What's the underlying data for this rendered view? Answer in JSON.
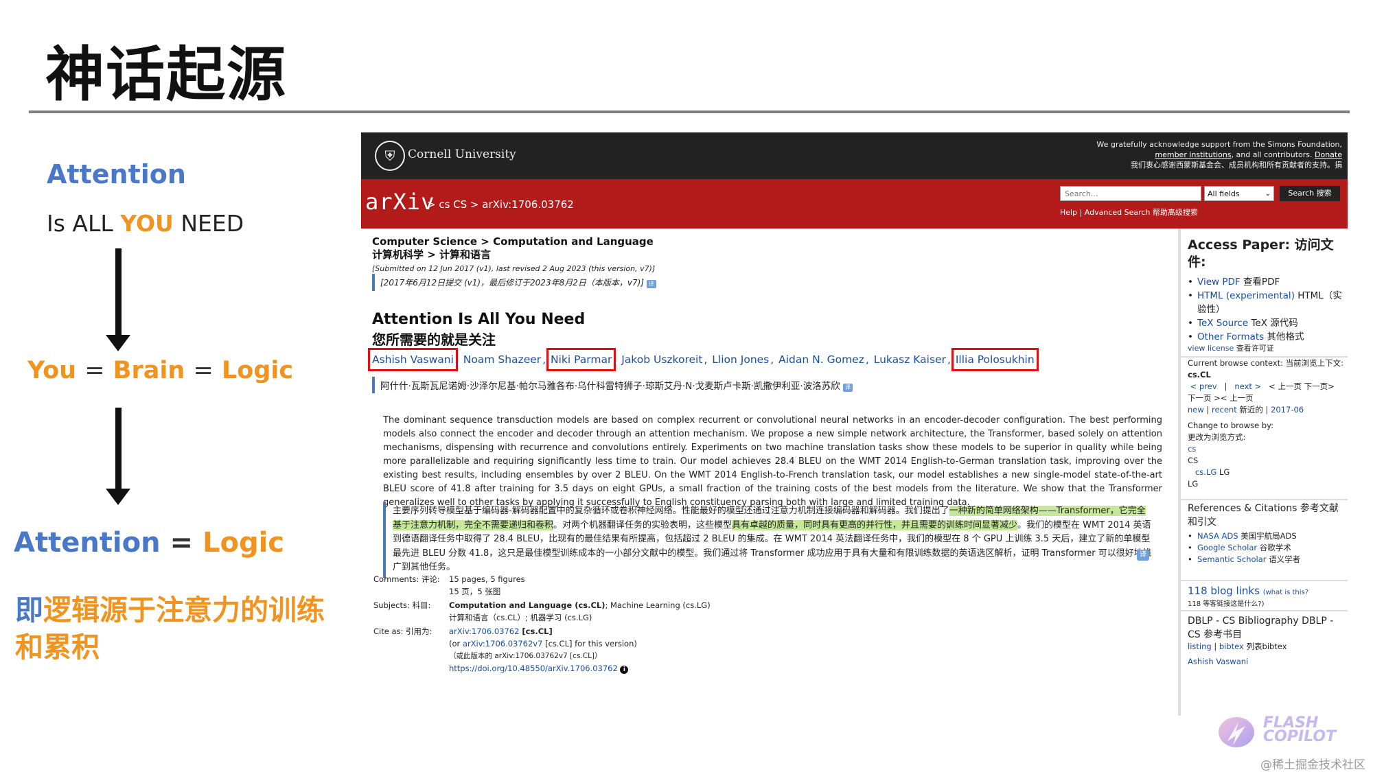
{
  "slide": {
    "title": "神话起源"
  },
  "left": {
    "attention": "Attention",
    "is_all_pre": "Is ALL ",
    "you": "YOU",
    "need": " NEED",
    "you2": "You",
    "eq": "=",
    "brain": "Brain",
    "logic": "Logic",
    "attention2": "Attention",
    "logic2": "Logic",
    "conclusion_ji": "即",
    "conclusion_rest": "逻辑源于注意力的训练和累积"
  },
  "arxiv": {
    "cornell": "Cornell University",
    "ack_line1": "We gratefully acknowledge support from the Simons Foundation,",
    "ack_member": "member institutions",
    "ack_mid": ", and all contributors.",
    "ack_donate": "Donate",
    "ack_cn": "我们衷心感谢西蒙斯基金会、成员机构和所有贡献者的支持。捐",
    "logo": "arXiv",
    "path": "> cs  CS  > arXiv:1706.03762",
    "search_placeholder": "Search...",
    "fields": "All fields",
    "search_button": "Search  搜索",
    "help_links": "Help | Advanced Search   帮助高级搜索",
    "crumbs_en": "Computer Science > Computation and Language",
    "crumbs_cn": "计算机科学 > 计算和语言",
    "submitted": "[Submitted on 12 Jun 2017 (v1), last revised 2 Aug 2023 (this version, v7)]",
    "submitted_cn": "[2017年6月12日提交 (v1)，最后修订于2023年8月2日（本版本，v7)]",
    "title": "Attention Is All You Need",
    "title_cn": "您所需要的就是关注",
    "authors": [
      "Ashish Vaswani",
      "Noam Shazeer",
      "Niki Parmar",
      "Jakob Uszkoreit",
      "Llion Jones",
      "Aidan N. Gomez",
      "Lukasz Kaiser",
      "Illia Polosukhin"
    ],
    "authors_cn": "阿什什·瓦斯瓦尼诺姆·沙泽尔尼基·帕尔马雅各布·乌什科雷特狮子·琼斯艾丹·N·戈麦斯卢卡斯·凯撒伊利亚·波洛苏欣",
    "abstract": "The dominant sequence transduction models are based on complex recurrent or convolutional neural networks in an encoder-decoder configuration. The best performing models also connect the encoder and decoder through an attention mechanism. We propose a new simple network architecture, the Transformer, based solely on attention mechanisms, dispensing with recurrence and convolutions entirely. Experiments on two machine translation tasks show these models to be superior in quality while being more parallelizable and requiring significantly less time to train. Our model achieves 28.4 BLEU on the WMT 2014 English-to-German translation task, improving over the existing best results, including ensembles by over 2 BLEU. On the WMT 2014 English-to-French translation task, our model establishes a new single-model state-of-the-art BLEU score of 41.8 after training for 3.5 days on eight GPUs, a small fraction of the training costs of the best models from the literature. We show that the Transformer generalizes well to other tasks by applying it successfully to English constituency parsing both with large and limited training data.",
    "abstract_cn_1": "主要序列转导模型基于编码器-解码器配置中的复杂循环或卷积神经网络。性能最好的模型还通过注意力机制连接编码器和解码器。我们提出了",
    "abstract_cn_hl1": "一种新的简单网络架构——Transformer，它完全基于注意力机制，完全不需要递归和卷积",
    "abstract_cn_2": "。对两个机器翻译任务的实验表明，这些模型",
    "abstract_cn_hl2": "具有卓越的质量，同时具有更高的并行性，并且需要的训练时间显著减少",
    "abstract_cn_3": "。我们的模型在 WMT 2014 英语到德语翻译任务中取得了 28.4 BLEU，比现有的最佳结果有所提高，包括超过 2 BLEU 的集成。在 WMT 2014 英法翻译任务中，我们的模型在 8 个 GPU 上训练 3.5 天后，建立了新的单模型最先进 BLEU 分数 41.8，这只是最佳模型训练成本的一小部分文献中的模型。我们通过将 Transformer 成功应用于具有大量和有限训练数据的英语选区解析，证明 Transformer 可以很好地推广到其他任务。",
    "meta": {
      "comments_label": "Comments:  评论:",
      "comments": "15 pages, 5 figures",
      "comments_cn": "15 页，5 张图",
      "subjects_label": "Subjects:  科目:",
      "subjects_bold": "Computation and Language (cs.CL)",
      "subjects_rest": "; Machine Learning (cs.LG)",
      "subjects_cn": "计算和语言（cs.CL）; 机器学习 (cs.LG)",
      "cite_label": "Cite as:  引用为:",
      "cite_link": "arXiv:1706.03762",
      "cite_tag": " [cs.CL]",
      "cite_or_pre": "(or ",
      "cite_or_link": "arXiv:1706.03762v7",
      "cite_or_post": " [cs.CL] for this version)",
      "cite_cn": "（或此版本的 arXiv:1706.03762v7 [cs.CL]）",
      "doi": "https://doi.org/10.48550/arXiv.1706.03762",
      "info_icon": "i"
    },
    "sidebar": {
      "access_title": "Access Paper: 访问文件:",
      "view_pdf": "View PDF",
      "view_pdf_cn": "查看PDF",
      "html": "HTML (experimental)",
      "html_cn": "HTML（实验性）",
      "tex": "TeX Source",
      "tex_cn": "TeX 源代码",
      "other": "Other Formats",
      "other_cn": "其他格式",
      "license": "view license",
      "license_cn": "查看许可证",
      "context1": "Current browse context:  当前浏览上下文:",
      "context2": "cs.CL",
      "prev": "< prev",
      "next": "next >",
      "prevnext_cn": "< 上一页 下一页>",
      "prevnext_cn2": "下一页 >< 上一页",
      "new": "new",
      "recent": "recent",
      "recent_cn": "新近的",
      "date": "2017-06",
      "change": "Change to browse by:",
      "change_cn": "更改为浏览方式:",
      "cs": "cs",
      "cs_plain": "CS",
      "cslg": "cs.LG",
      "lg": "LG",
      "lg2": "LG",
      "refs_title": "References & Citations  参考文献和引文",
      "nasa": "NASA ADS",
      "nasa_cn": "美国宇航局ADS",
      "google": "Google Scholar",
      "google_cn": "谷歌学术",
      "semantic": "Semantic Scholar",
      "semantic_cn": "语义学者",
      "blog": "118 blog links",
      "blog_what": "(what is this?",
      "blog_cn": "118 等客链接这是什么?)",
      "dblp": "DBLP - CS Bibliography  DBLP - CS 参考书目",
      "listing": "listing",
      "bibtex": "bibtex",
      "bibtex_cn": "列表bibtex",
      "author_link": "Ashish Vaswani"
    },
    "translate_icon": "译"
  },
  "watermark": {
    "flash": "FLASH",
    "copilot": "COPILOT",
    "credit": "@稀土掘金技术社区"
  }
}
